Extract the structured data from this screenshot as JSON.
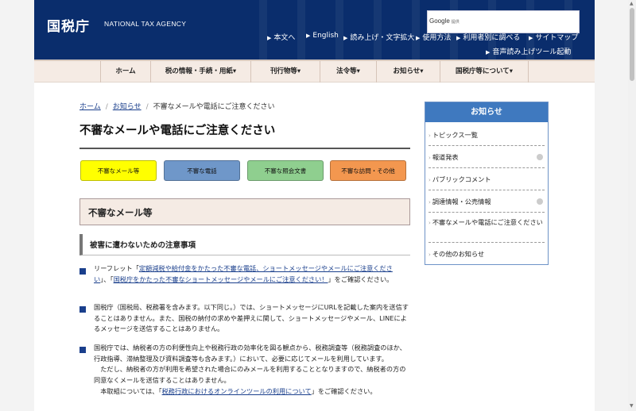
{
  "header": {
    "logo": "国税庁",
    "logo_en": "NATIONAL TAX AGENCY",
    "search": {
      "brand": "Google",
      "provided": "提供"
    },
    "util_row1": [
      "本文へ",
      "English",
      "読み上げ・文字拡大",
      "使用方法",
      "利用者別に調べる",
      "サイトマップ"
    ],
    "util_row2": "音声読み上げツール起動"
  },
  "nav": [
    "ホーム",
    "税の情報・手続・用紙",
    "刊行物等",
    "法令等",
    "お知らせ",
    "国税庁等について"
  ],
  "breadcrumb": [
    "ホーム",
    "お知らせ",
    "不審なメールや電話にご注意ください"
  ],
  "page_title": "不審なメールや電話にご注意ください",
  "tabs": [
    {
      "label": "不審なメール等",
      "color": "#ffff00"
    },
    {
      "label": "不審な電話",
      "color": "#6f97c9"
    },
    {
      "label": "不審な照会文書",
      "color": "#8fcf8f"
    },
    {
      "label": "不審な訪問・その他",
      "color": "#f3974f"
    }
  ],
  "section_title": "不審なメール等",
  "subsection_title": "被害に遭わないための注意事項",
  "items": {
    "p1": {
      "pre": "リーフレット「",
      "link1": "定額減税や給付金をかたった不審な電話、ショートメッセージやメールにご注意ください",
      "mid": "」、「",
      "link2": "国税庁をかたった不審なショートメッセージやメールにご注意ください！",
      "post": "」をご確認ください。"
    },
    "p2": "国税庁（国税局、税務署を含みます。以下同じ。）では、ショートメッセージにURLを記載した案内を送信することはありません。また、国税の納付の求めや差押えに関して、ショートメッセージやメール、LINEによるメッセージを送信することはありません。",
    "p3": {
      "main": "国税庁では、納税者の方の利便性向上や税務行政の効率化を図る観点から、税務調査等（税務調査のほか、行政指導、滞納整理及び資料調査等も含みます。）において、必要に応じてメールを利用しています。",
      "line2": "ただし、納税者の方が利用を希望された場合にのみメールを利用することとなりますので、納税者の方の同意なくメールを送信することはありません。",
      "line3_pre": "本取組については、「",
      "line3_link": "税務行政におけるオンラインツールの利用について",
      "line3_post": "」をご確認ください。"
    }
  },
  "sidebar": {
    "title": "お知らせ",
    "items": [
      "トピックス一覧",
      "報道発表",
      "パブリックコメント",
      "調達情報・公売情報",
      "不審なメールや電話にご注意ください",
      "その他のお知らせ"
    ]
  }
}
